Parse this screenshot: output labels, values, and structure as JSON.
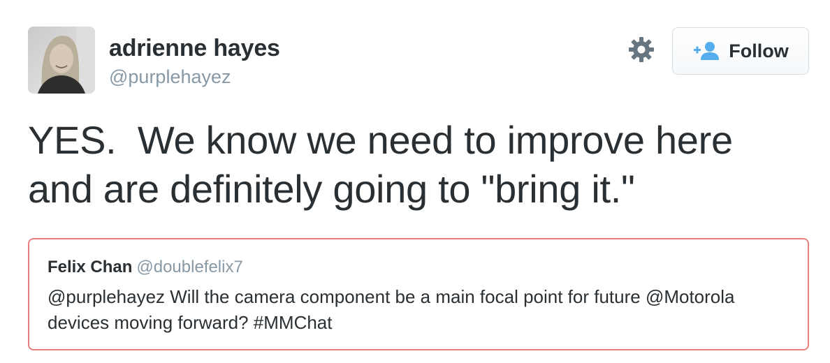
{
  "author": {
    "name": "adrienne hayes",
    "handle": "@purplehayez"
  },
  "actions": {
    "settings_icon": "gear-icon",
    "follow_icon": "add-user-icon",
    "follow_label": "Follow"
  },
  "tweet": {
    "text": "YES.  We know we need to improve here\nand are definitely going to \"bring it.\""
  },
  "quoted_tweet": {
    "name": "Felix Chan",
    "handle": "@doublefelix7",
    "text": "@purplehayez Will the camera component be a main focal point for future @Motorola devices moving forward? #MMChat"
  },
  "colors": {
    "text": "#292f33",
    "muted": "#8899a6",
    "follow_icon": "#55acee",
    "gear": "#66757f",
    "quote_border": "#e87f7f"
  }
}
